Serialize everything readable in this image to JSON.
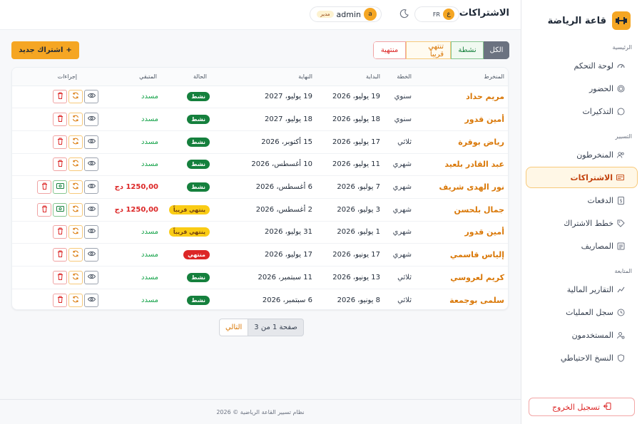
{
  "brand": {
    "title": "قاعة الرياضة",
    "logo_icon": "dumbbell-icon"
  },
  "sidebar": {
    "sections": [
      {
        "label": "الرئيسية",
        "items": [
          {
            "label": "لوحة التحكم",
            "icon": "dashboard-icon"
          },
          {
            "label": "الحضور",
            "icon": "fingerprint-icon"
          },
          {
            "label": "التذكيرات",
            "icon": "whatsapp-icon"
          }
        ]
      },
      {
        "label": "التسيير",
        "items": [
          {
            "label": "المنخرطون",
            "icon": "users-icon"
          },
          {
            "label": "الاشتراكات",
            "icon": "card-icon",
            "active": true
          },
          {
            "label": "الدفعات",
            "icon": "receipt-icon"
          },
          {
            "label": "خطط الاشتراك",
            "icon": "tag-icon"
          },
          {
            "label": "المصاريف",
            "icon": "expense-icon"
          }
        ]
      },
      {
        "label": "المتابعة",
        "items": [
          {
            "label": "التقارير المالية",
            "icon": "chart-icon"
          },
          {
            "label": "سجل العمليات",
            "icon": "clock-icon"
          },
          {
            "label": "المستخدمون",
            "icon": "user-cog-icon"
          },
          {
            "label": "النسخ الاحتياطي",
            "icon": "shield-icon"
          }
        ]
      }
    ],
    "logout_label": "تسجيل الخروج"
  },
  "topbar": {
    "title": "الاشتراكات",
    "lang_badge": "ع",
    "lang_alt": "FR",
    "user_initial": "a",
    "user_name": "admin",
    "user_role": "مدير"
  },
  "filters": {
    "all": "الكل",
    "active": "نشطة",
    "soon": "تنتهي قريباً",
    "ended": "منتهية"
  },
  "new_button": "اشتراك جديد",
  "table": {
    "headers": {
      "member": "المنخرط",
      "plan": "الخطة",
      "start": "البداية",
      "end": "النهاية",
      "status": "الحالة",
      "remaining": "المتبقي",
      "actions": "إجراءات"
    },
    "rows": [
      {
        "member": "مريم حداد",
        "plan": "سنوي",
        "start": "19 يوليو، 2026",
        "end": "19 يوليو، 2027",
        "status": "نشط",
        "status_kind": "active",
        "remaining": "مسدد",
        "owed": false
      },
      {
        "member": "أمين قدور",
        "plan": "سنوي",
        "start": "18 يوليو، 2026",
        "end": "18 يوليو، 2027",
        "status": "نشط",
        "status_kind": "active",
        "remaining": "مسدد",
        "owed": false
      },
      {
        "member": "رياض بوقرة",
        "plan": "ثلاثي",
        "start": "17 يوليو، 2026",
        "end": "15 أكتوبر، 2026",
        "status": "نشط",
        "status_kind": "active",
        "remaining": "مسدد",
        "owed": false
      },
      {
        "member": "عبد القادر بلعيد",
        "plan": "شهري",
        "start": "11 يوليو، 2026",
        "end": "10 أغسطس، 2026",
        "status": "نشط",
        "status_kind": "active",
        "remaining": "مسدد",
        "owed": false
      },
      {
        "member": "نور الهدى شريف",
        "plan": "شهري",
        "start": "7 يوليو، 2026",
        "end": "6 أغسطس، 2026",
        "status": "نشط",
        "status_kind": "active",
        "remaining": "1250,00 دج",
        "owed": true
      },
      {
        "member": "جمال بلحسن",
        "plan": "شهري",
        "start": "3 يوليو، 2026",
        "end": "2 أغسطس، 2026",
        "status": "ينتهي قريباً",
        "status_kind": "soon",
        "remaining": "1250,00 دج",
        "owed": true
      },
      {
        "member": "أمين قدور",
        "plan": "شهري",
        "start": "1 يوليو، 2026",
        "end": "31 يوليو، 2026",
        "status": "ينتهي قريباً",
        "status_kind": "soon",
        "remaining": "مسدد",
        "owed": false
      },
      {
        "member": "إلياس قاسمي",
        "plan": "شهري",
        "start": "17 يونيو، 2026",
        "end": "17 يوليو، 2026",
        "status": "منتهي",
        "status_kind": "ended",
        "remaining": "مسدد",
        "owed": false
      },
      {
        "member": "كريم لعروسي",
        "plan": "ثلاثي",
        "start": "13 يونيو، 2026",
        "end": "11 سبتمبر، 2026",
        "status": "نشط",
        "status_kind": "active",
        "remaining": "مسدد",
        "owed": false
      },
      {
        "member": "سلمى بوجمعة",
        "plan": "ثلاثي",
        "start": "8 يونيو، 2026",
        "end": "6 سبتمبر، 2026",
        "status": "نشط",
        "status_kind": "active",
        "remaining": "مسدد",
        "owed": false
      }
    ]
  },
  "pagination": {
    "info": "صفحة 1 من 3",
    "next": "التالي"
  },
  "footer": "نظام تسيير القاعة الرياضية © 2026",
  "colors": {
    "accent": "#f5a623",
    "active": "#15803d",
    "soon": "#facc15",
    "ended": "#dc2626"
  }
}
